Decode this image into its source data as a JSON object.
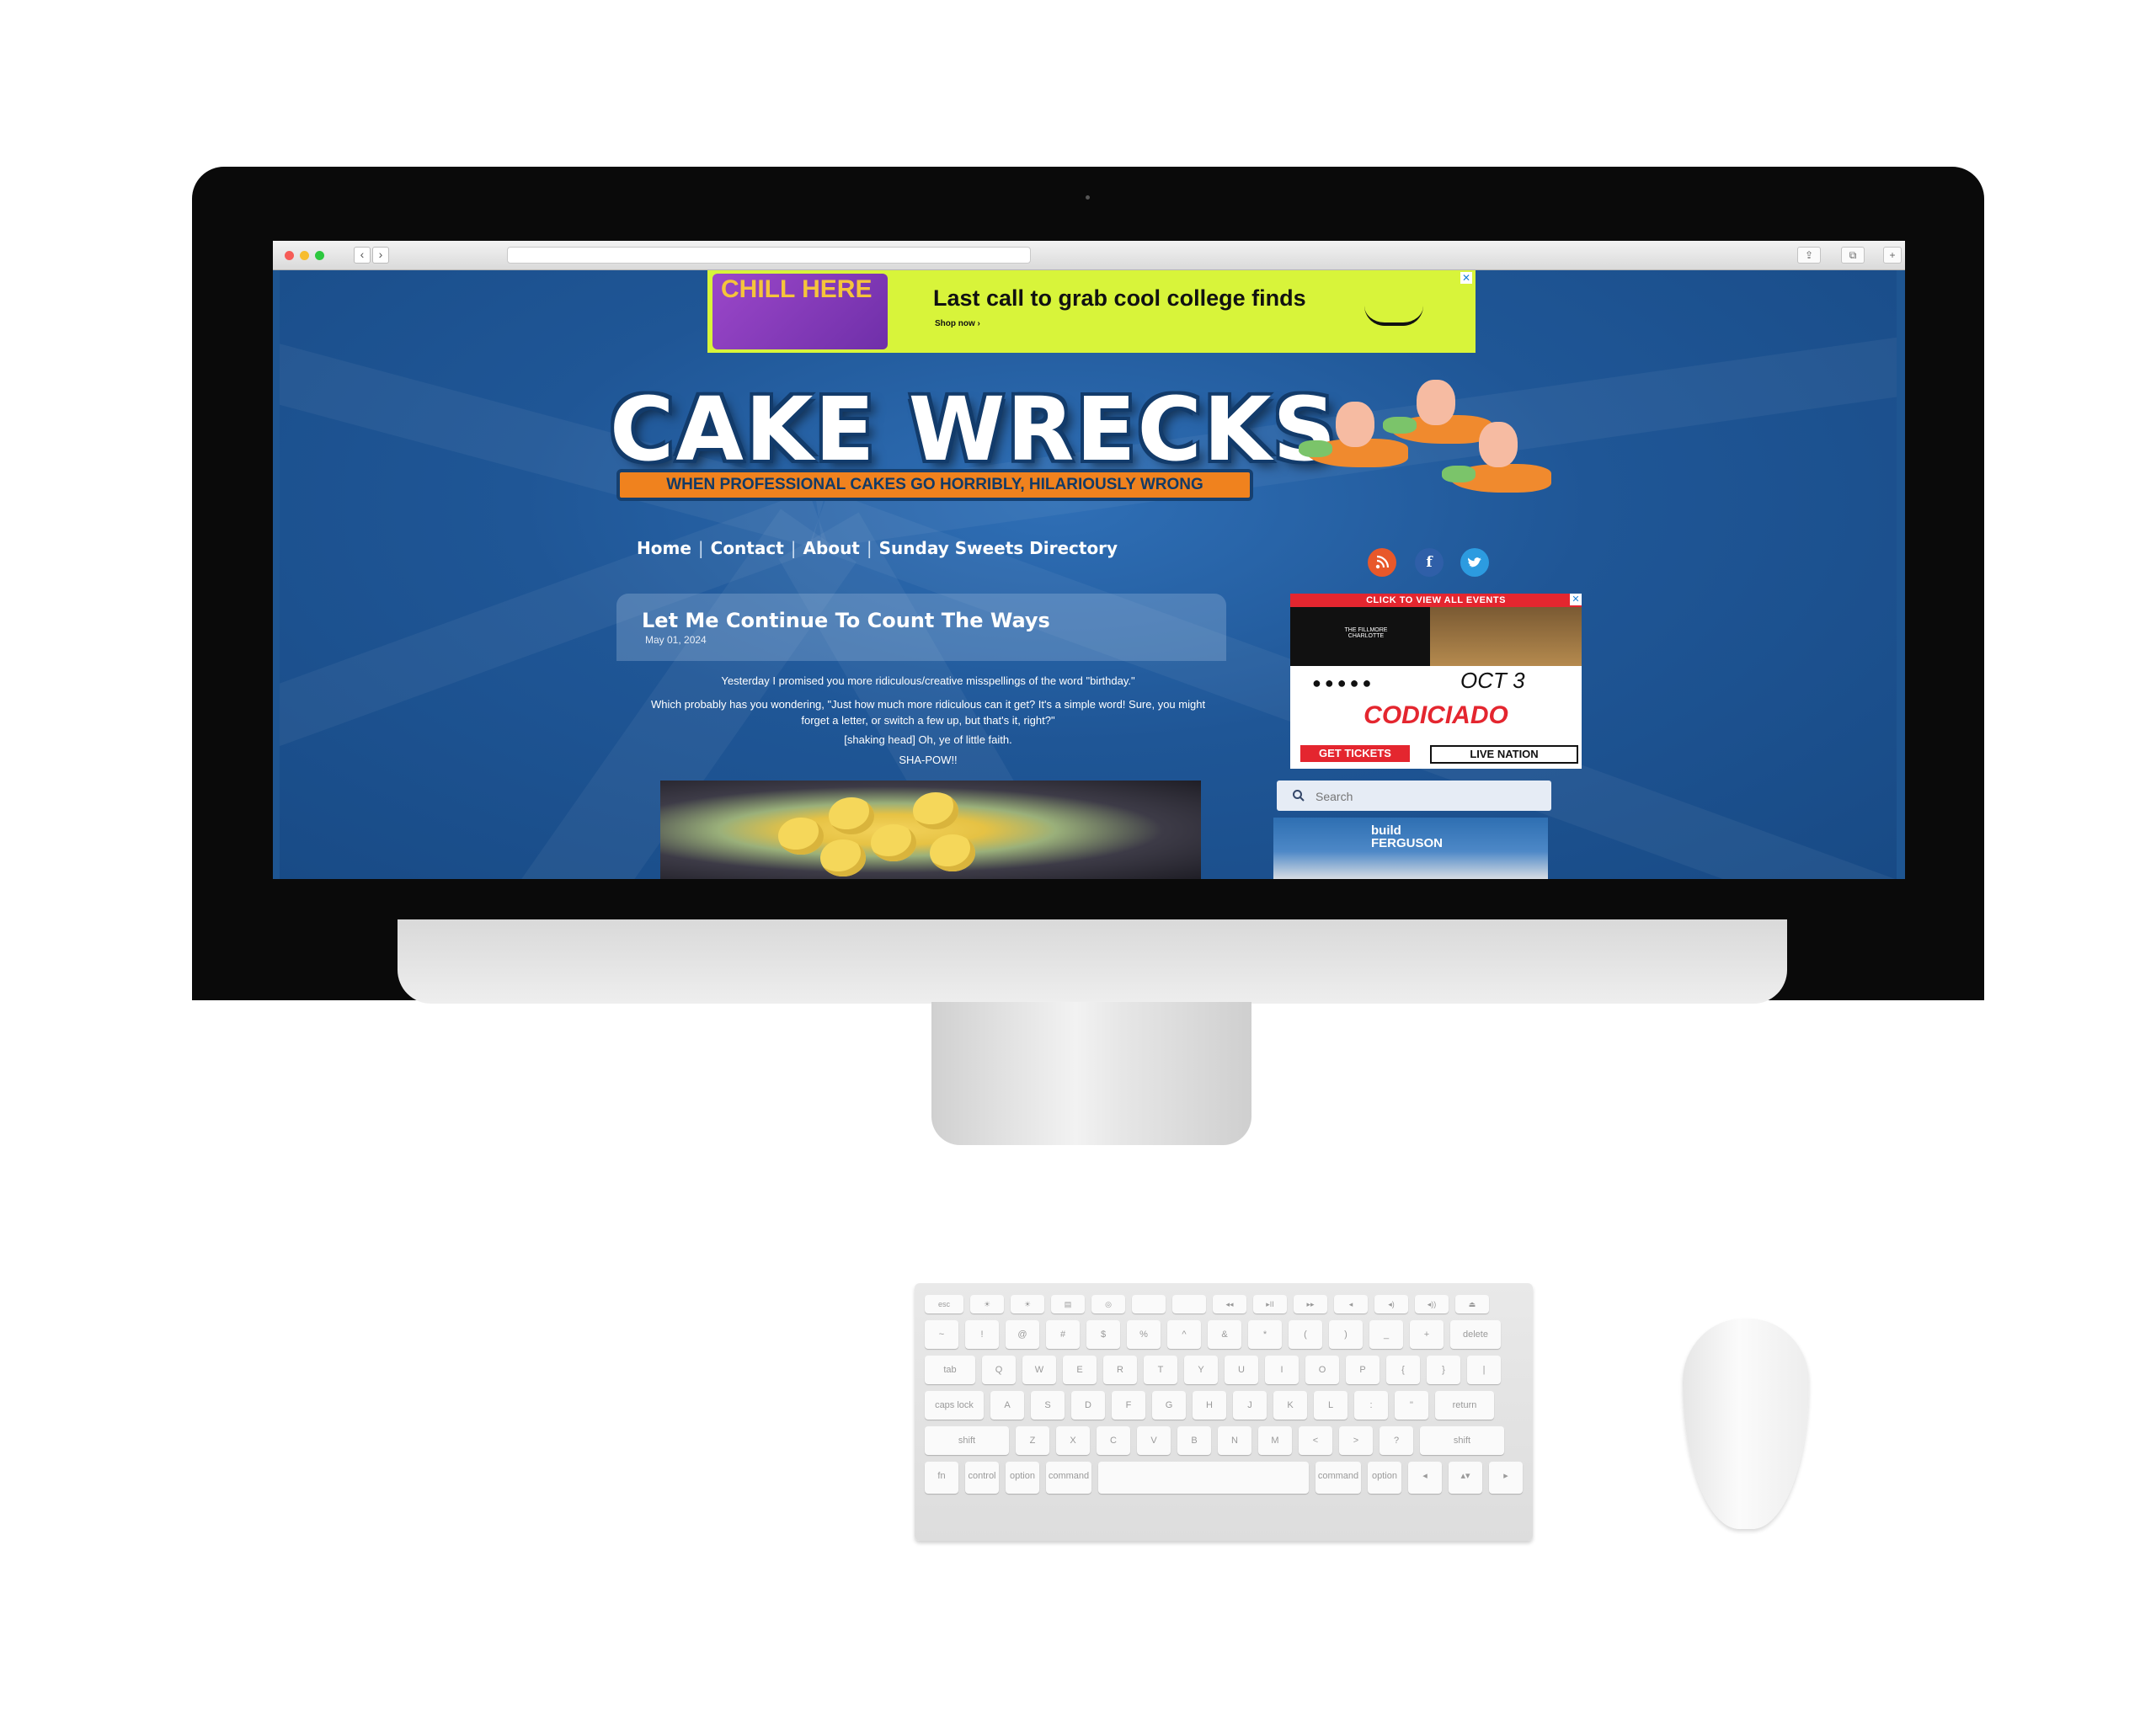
{
  "browser": {
    "back_icon": "‹",
    "forward_icon": "›",
    "share_icon": "⇪",
    "tabs_icon": "⧉",
    "new_tab_icon": "+"
  },
  "top_ad": {
    "art_text": "CHILL HERE",
    "headline": "Last call to grab cool college finds",
    "cta": "Shop now ›",
    "close": "✕"
  },
  "site": {
    "logo_title": "CAKE WRECKS",
    "tagline": "WHEN PROFESSIONAL CAKES GO HORRIBLY, HILARIOUSLY WRONG"
  },
  "nav": {
    "items": [
      "Home",
      "Contact",
      "About",
      "Sunday Sweets Directory"
    ],
    "separator": "|"
  },
  "social": {
    "rss": "rss-icon",
    "facebook": "f",
    "twitter": "t",
    "colors": {
      "rss": "#e8582a",
      "facebook": "#2f5fa8",
      "twitter": "#2c9be0"
    }
  },
  "post": {
    "title": "Let Me Continue To Count The Ways",
    "date": "May 01, 2024",
    "paragraphs": [
      "Yesterday I promised you more ridiculous/creative misspellings of the word \"birthday.\"",
      "Which probably has you wondering, \"Just how much more ridiculous can it get? It's a simple word! Sure, you might forget a letter, or switch a few up, but that's it, right?\"",
      "[shaking head] Oh, ye of little faith.",
      "SHA-POW!!"
    ]
  },
  "side_ad": {
    "banner": "CLICK TO VIEW ALL EVENTS",
    "venue": "THE FILLMORE CHARLOTTE",
    "dots": "●●●●●",
    "date": "OCT 3",
    "artist": "CODICIADO",
    "cta": "GET TICKETS",
    "promoter": "LIVE NATION",
    "close": "✕"
  },
  "search": {
    "placeholder": "Search"
  },
  "side_ad2": {
    "brand_line1": "build",
    "brand_line2": "FERGUSON"
  },
  "keyboard": {
    "row1": [
      "esc",
      "☀",
      "☀",
      "▤",
      "◎",
      "",
      "",
      "◂◂",
      "▸II",
      "▸▸",
      "◂",
      "◂)",
      "◂))",
      "⏏"
    ],
    "row2": [
      "~",
      "!",
      "@",
      "#",
      "$",
      "%",
      "^",
      "&",
      "*",
      "(",
      ")",
      "_",
      "+",
      "delete"
    ],
    "row3": [
      "tab",
      "Q",
      "W",
      "E",
      "R",
      "T",
      "Y",
      "U",
      "I",
      "O",
      "P",
      "{",
      "}",
      "|"
    ],
    "row4": [
      "caps lock",
      "A",
      "S",
      "D",
      "F",
      "G",
      "H",
      "J",
      "K",
      "L",
      ":",
      "\"",
      "return"
    ],
    "row5": [
      "shift",
      "Z",
      "X",
      "C",
      "V",
      "B",
      "N",
      "M",
      "<",
      ">",
      "?",
      "shift"
    ],
    "row6": [
      "fn",
      "control",
      "option",
      "command",
      "",
      "command",
      "option",
      "◂",
      "▴▾",
      "▸"
    ]
  }
}
